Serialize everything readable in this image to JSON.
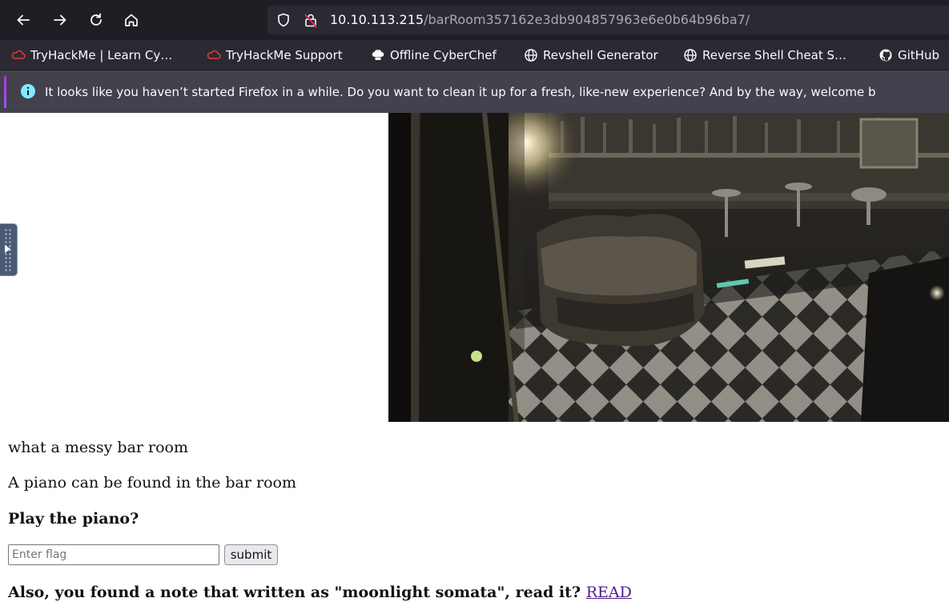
{
  "browser": {
    "url_host": "10.10.113.215",
    "url_path": "/barRoom357162e3db904857963e6e0b64b96ba7/"
  },
  "bookmarks": [
    {
      "label": "TryHackMe | Learn Cy…",
      "icon": "tryhackme-icon"
    },
    {
      "label": "TryHackMe Support",
      "icon": "tryhackme-icon"
    },
    {
      "label": "Offline CyberChef",
      "icon": "chef-hat-icon"
    },
    {
      "label": "Revshell Generator",
      "icon": "globe-icon"
    },
    {
      "label": "Reverse Shell Cheat S…",
      "icon": "globe-icon"
    },
    {
      "label": "GitHub",
      "icon": "github-icon"
    }
  ],
  "notification": {
    "text": "It looks like you haven’t started Firefox in a while. Do you want to clean it up for a fresh, like-new experience? And by the way, welcome b"
  },
  "page": {
    "description": "what a messy bar room",
    "piano_text": "A piano can be found in the bar room",
    "question": "Play the piano?",
    "flag_placeholder": "Enter flag",
    "submit_label": "submit",
    "note_text": "Also, you found a note that written as \"moonlight somata\", read it?",
    "read_link": "READ"
  },
  "colors": {
    "toolbar_bg": "#1f1e25",
    "urlbar_bg": "#2b2a33",
    "notice_bg": "#42414d",
    "link_visited": "#551a8b"
  }
}
